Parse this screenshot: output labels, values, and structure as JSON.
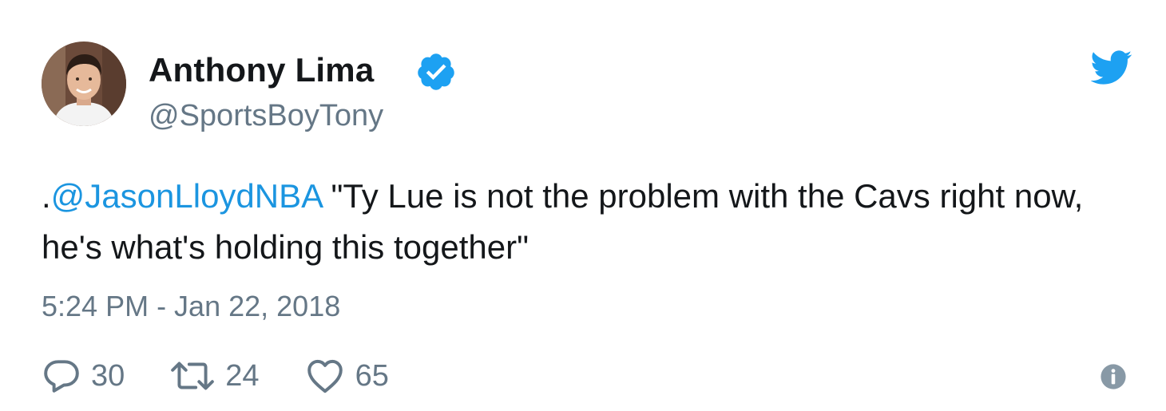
{
  "author": {
    "display_name": "Anthony Lima",
    "handle": "@SportsBoyTony",
    "verified": true
  },
  "tweet": {
    "prefix": ".",
    "mention": "@JasonLloydNBA",
    "body": " \"Ty Lue is not the problem with the Cavs right now, he's what's holding this together\"",
    "timestamp": "5:24 PM - Jan 22, 2018"
  },
  "actions": {
    "replies": "30",
    "retweets": "24",
    "likes": "65"
  },
  "icons": {
    "brand": "twitter-bird-icon",
    "verified": "verified-badge-icon",
    "reply": "reply-icon",
    "retweet": "retweet-icon",
    "like": "heart-icon",
    "info": "info-icon"
  },
  "colors": {
    "brand_blue": "#1da1f2",
    "link_blue": "#1b95e0",
    "secondary_gray": "#657786",
    "text_dark": "#14171a"
  }
}
